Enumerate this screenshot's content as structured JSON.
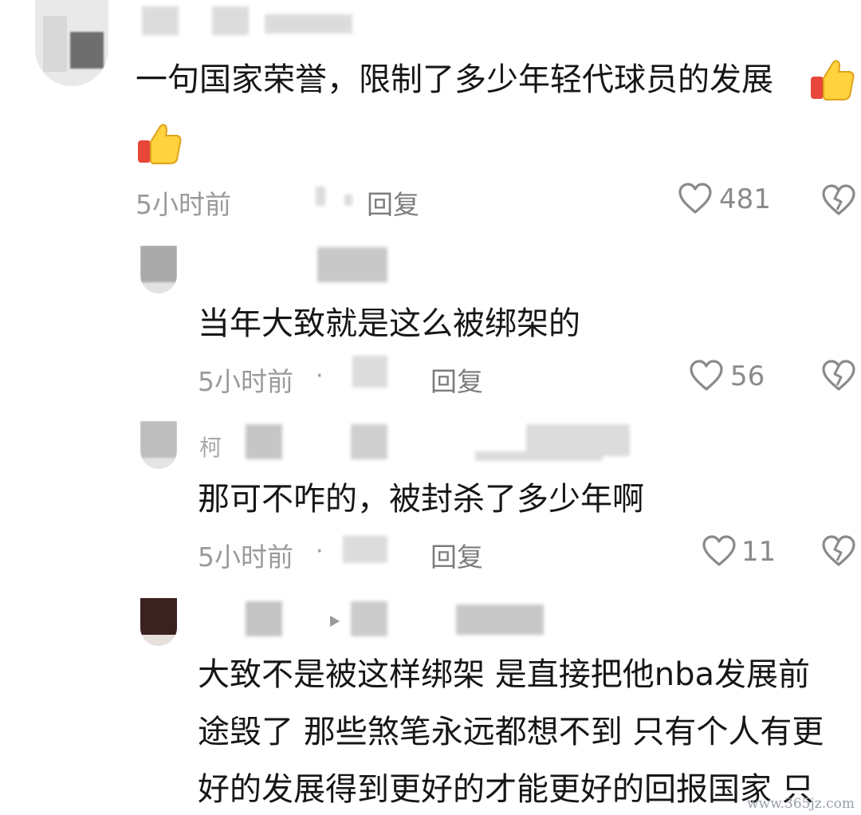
{
  "comments": [
    {
      "text": "一句国家荣誉，限制了多少年轻代球员的发展",
      "time": "5小时前",
      "reply_label": "回复",
      "likes": "481"
    },
    {
      "text": "当年大致就是这么被绑架的",
      "time": "5小时前",
      "reply_label": "回复",
      "likes": "56"
    },
    {
      "author_partial": "柯",
      "text": "那可不咋的，被封杀了多少年啊",
      "time": "5小时前",
      "reply_label": "回复",
      "likes": "11"
    },
    {
      "text_lines": [
        "大致不是被这样绑架 是直接把他nba发展前",
        "途毁了 那些煞笔永远都想不到 只有个人有更",
        "好的发展得到更好的才能更好的回报国家 只"
      ]
    }
  ],
  "watermark": "www.365jz.com",
  "dot_separator": "·",
  "icons": {
    "like": "heart-outline-icon",
    "dislike": "broken-heart-icon",
    "thumbs_up": "thumbs-up-emoji"
  }
}
